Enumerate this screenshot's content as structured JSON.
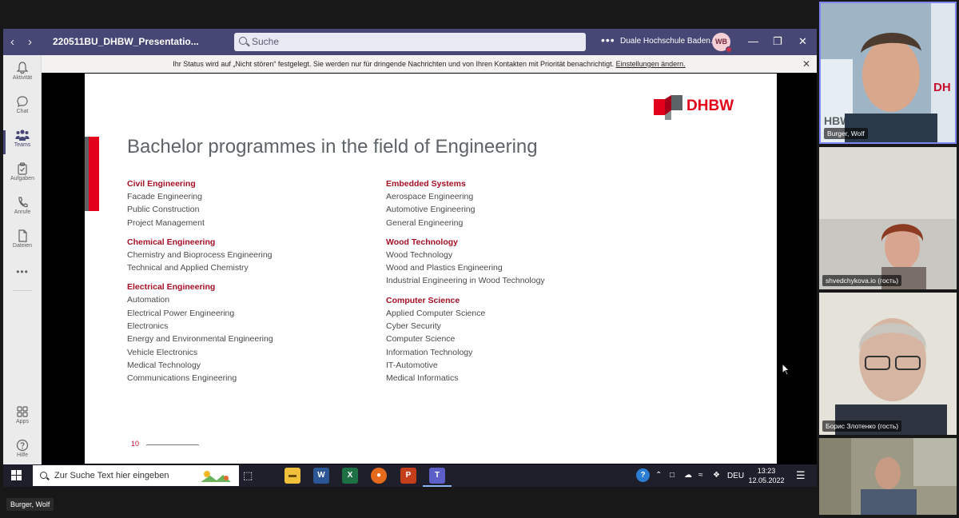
{
  "teams": {
    "window_title": "220511BU_DHBW_Presentatio...",
    "search_placeholder": "Suche",
    "organization": "Duale Hochschule Baden...",
    "avatar_initials": "WB",
    "notification": {
      "text": "Ihr Status wird auf „Nicht stören“ festgelegt. Sie werden nur für dringende Nachrichten und von Ihren Kontakten mit Priorität benachrichtigt.",
      "link": "Einstellungen ändern."
    },
    "rail": [
      {
        "label": "Aktivität",
        "icon": "bell-icon"
      },
      {
        "label": "Chat",
        "icon": "chat-icon"
      },
      {
        "label": "Teams",
        "icon": "teams-icon"
      },
      {
        "label": "Aufgaben",
        "icon": "tasks-icon"
      },
      {
        "label": "Anrufe",
        "icon": "phone-icon"
      },
      {
        "label": "Dateien",
        "icon": "file-icon"
      },
      {
        "label": "Apps",
        "icon": "apps-icon"
      },
      {
        "label": "Hilfe",
        "icon": "help-icon"
      }
    ]
  },
  "slide": {
    "logo_text": "DHBW",
    "title": "Bachelor programmes in the field of Engineering",
    "page_number": "10",
    "columns": [
      [
        {
          "heading": "Civil Engineering",
          "items": [
            "Facade Engineering",
            "Public Construction",
            "Project Management"
          ]
        },
        {
          "heading": "Chemical Engineering",
          "items": [
            "Chemistry and Bioprocess Engineering",
            "Technical and Applied Chemistry"
          ]
        },
        {
          "heading": "Electrical Engineering",
          "items": [
            "Automation",
            "Electrical Power Engineering",
            "Electronics",
            "Energy and Environmental Engineering",
            "Vehicle Electronics",
            "Medical Technology",
            "Communications Engineering"
          ]
        }
      ],
      [
        {
          "heading": "Embedded Systems",
          "items": [
            "Aerospace Engineering",
            "Automotive Engineering",
            "General Engineering"
          ]
        },
        {
          "heading": "Wood Technology",
          "items": [
            "Wood Technology",
            "Wood and Plastics Engineering",
            "Industrial Engineering in Wood Technology"
          ]
        },
        {
          "heading": "Computer Science",
          "items": [
            "Applied Computer Science",
            "Cyber Security",
            "Computer Science",
            "Information Technology",
            "IT-Automotive",
            "Medical Informatics"
          ]
        }
      ]
    ]
  },
  "participants": [
    {
      "name": "Burger, Wolf"
    },
    {
      "name": "shvedchykova.io (гость)"
    },
    {
      "name": "Борис Злотенко (гость)"
    },
    {
      "name": ""
    }
  ],
  "taskbar": {
    "search_placeholder": "Zur Suche Text hier eingeben",
    "language": "DEU",
    "time": "13:23",
    "date": "12.05.2022",
    "apps": [
      "Explorer",
      "Word",
      "Excel",
      "Firefox",
      "PowerPoint",
      "Teams"
    ]
  },
  "presenter_label": "Burger, Wolf",
  "colors": {
    "teams_purple": "#464775",
    "dhbw_red": "#e2001a",
    "heading_red": "#a50f26"
  }
}
